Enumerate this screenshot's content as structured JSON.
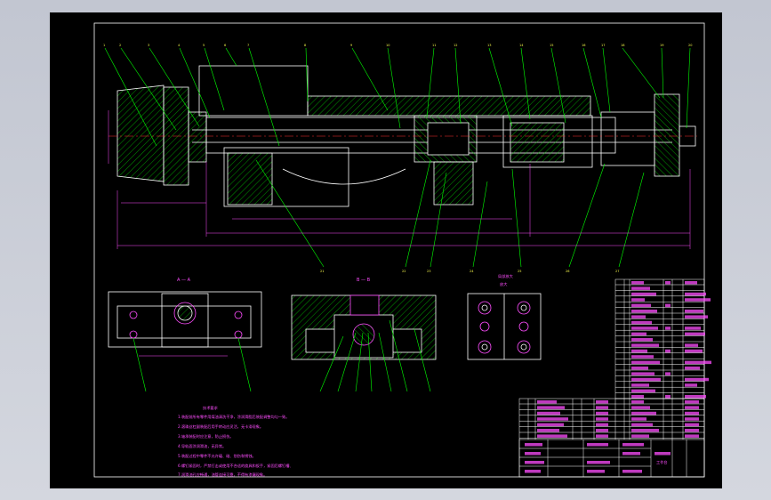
{
  "drawing": {
    "section_a": "A — A",
    "section_b": "B — B",
    "detail_caption": [
      "局部放大",
      "放大"
    ],
    "tech_req_title": "技术要求",
    "tech_req_lines": [
      "1.装配前所有零件用煤油清洗干净，涂润滑脂后装配调整均匀一致。",
      "2.滚珠丝杠副装配后用手转动应灵活，无卡滞现象。",
      "3.轴承装配时应注意，防止损伤。",
      "4.导轨面涂润滑油，无异常。",
      "5.装配过程中零件不允许磕、碰、划伤和锈蚀。",
      "6.螺钉紧固时，严禁打击或使用不合适的旋具和扳手，紧固后螺钉槽、",
      "7.润滑油孔应畅通，油管连接可靠，不得有渗漏现象。"
    ],
    "title_block_name": "工作台"
  },
  "colors": {
    "background": "#000000",
    "outline": "#ffffff",
    "leader": "#00ff00",
    "dimension": "#ff4dff",
    "center": "#ff3333",
    "hatch": "#00ff00",
    "balloon_text": "#ffff4d",
    "window": "#c9ccd6"
  }
}
